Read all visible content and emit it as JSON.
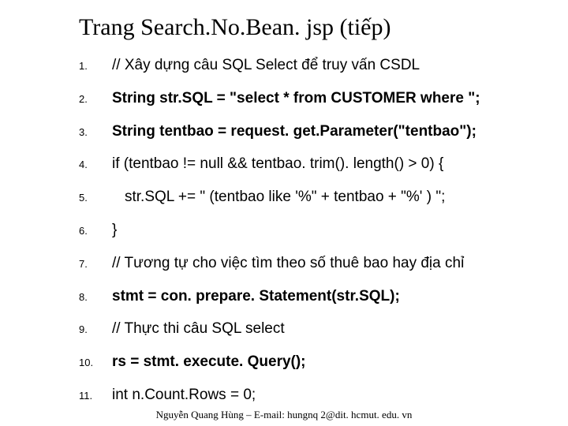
{
  "title": "Trang Search.No.Bean. jsp (tiếp)",
  "items": [
    {
      "num": "1.",
      "text": "// Xây dựng câu SQL Select để truy vấn CSDL",
      "bold": false,
      "indent": false
    },
    {
      "num": "2.",
      "text": "String str.SQL = \"select * from CUSTOMER where \";",
      "bold": true,
      "indent": false
    },
    {
      "num": "3.",
      "text": "String tentbao = request. get.Parameter(\"tentbao\");",
      "bold": true,
      "indent": false
    },
    {
      "num": "4.",
      "text": "if (tentbao != null && tentbao. trim(). length() > 0) {",
      "bold": false,
      "indent": false
    },
    {
      "num": "5.",
      "text": "str.SQL += \" (tentbao like '%\" + tentbao + \"%' ) \";",
      "bold": false,
      "indent": true
    },
    {
      "num": "6.",
      "text": "}",
      "bold": false,
      "indent": false
    },
    {
      "num": "7.",
      "text": "// Tương tự cho việc tìm theo số thuê bao hay địa chỉ",
      "bold": false,
      "indent": false
    },
    {
      "num": "8.",
      "text": "stmt = con. prepare. Statement(str.SQL);",
      "bold": true,
      "indent": false
    },
    {
      "num": "9.",
      "text": "// Thực thi câu SQL select",
      "bold": false,
      "indent": false
    },
    {
      "num": "10.",
      "text": "rs = stmt. execute. Query();",
      "bold": true,
      "indent": false
    },
    {
      "num": "11.",
      "text": "int n.Count.Rows = 0;",
      "bold": false,
      "indent": false
    }
  ],
  "footer": "Nguyễn Quang Hùng – E-mail: hungnq 2@dit. hcmut. edu. vn"
}
